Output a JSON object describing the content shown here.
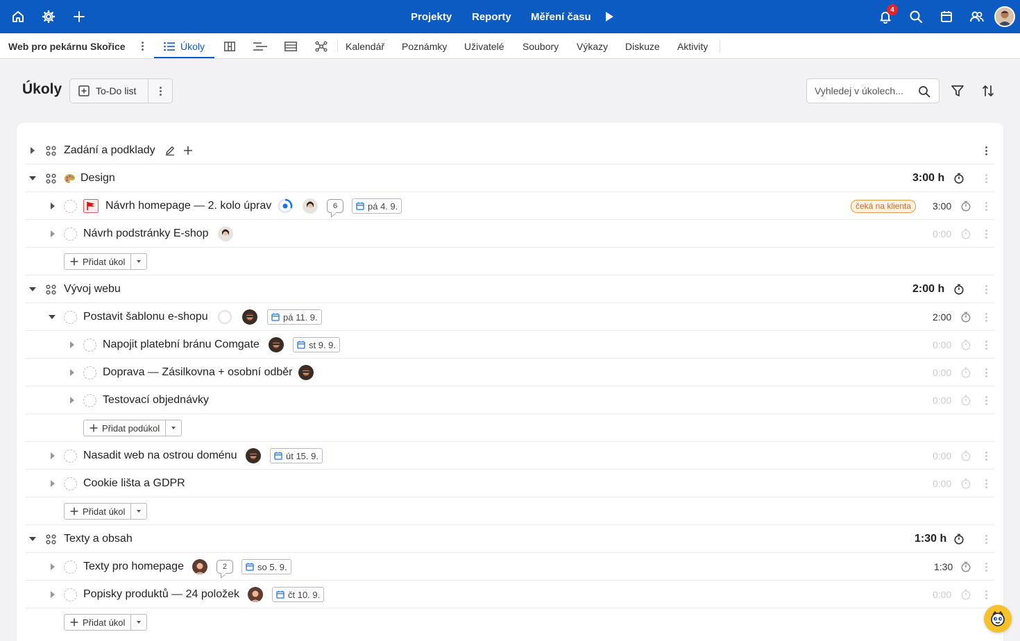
{
  "topbar": {
    "nav": [
      "Projekty",
      "Reporty",
      "Měření času"
    ],
    "notifications_count": "4",
    "colors": {
      "bar": "#0c5bc2",
      "badge": "#e3242b"
    }
  },
  "subnav": {
    "project_name": "Web pro pekárnu Skořice",
    "active_tab": "Úkoly",
    "tabs": [
      "Kalendář",
      "Poznámky",
      "Uživatelé",
      "Soubory",
      "Výkazy",
      "Diskuze",
      "Aktivity"
    ]
  },
  "header": {
    "title": "Úkoly",
    "todo_label": "To-Do list",
    "search_placeholder": "Vyhledej v úkolech..."
  },
  "groups": {
    "zadani": {
      "title": "Zadání a podklady"
    },
    "design": {
      "title": "Design",
      "time": "3:00 h"
    },
    "vyvoj": {
      "title": "Vývoj webu",
      "time": "2:00 h"
    },
    "texty": {
      "title": "Texty a obsah",
      "time": "1:30 h"
    }
  },
  "tasks": {
    "t1": {
      "title": "Návrh homepage — 2. kolo úprav",
      "comments": "6",
      "date": "pá 4. 9.",
      "status": "čeká na klienta",
      "time": "3:00"
    },
    "t2": {
      "title": "Návrh podstránky E-shop",
      "time": "0:00"
    },
    "t3": {
      "title": "Postavit šablonu e-shopu",
      "date": "pá 11. 9.",
      "time": "2:00"
    },
    "t4": {
      "title": "Napojit platební bránu Comgate",
      "date": "st 9. 9.",
      "time": "0:00"
    },
    "t5": {
      "title": "Doprava — Zásilkovna + osobní odběr",
      "time": "0:00"
    },
    "t6": {
      "title": "Testovací objednávky",
      "time": "0:00"
    },
    "t7": {
      "title": "Nasadit web na ostrou doménu",
      "date": "út 15. 9.",
      "time": "0:00"
    },
    "t8": {
      "title": "Cookie lišta a GDPR",
      "time": "0:00"
    },
    "t9": {
      "title": "Texty pro homepage",
      "comments": "2",
      "date": "so 5. 9.",
      "time": "1:30"
    },
    "t10": {
      "title": "Popisky produktů — 24 položek",
      "date": "čt 10. 9.",
      "time": "0:00"
    }
  },
  "buttons": {
    "add_task": "Přidat úkol",
    "add_subtask": "Přidat podúkol"
  }
}
